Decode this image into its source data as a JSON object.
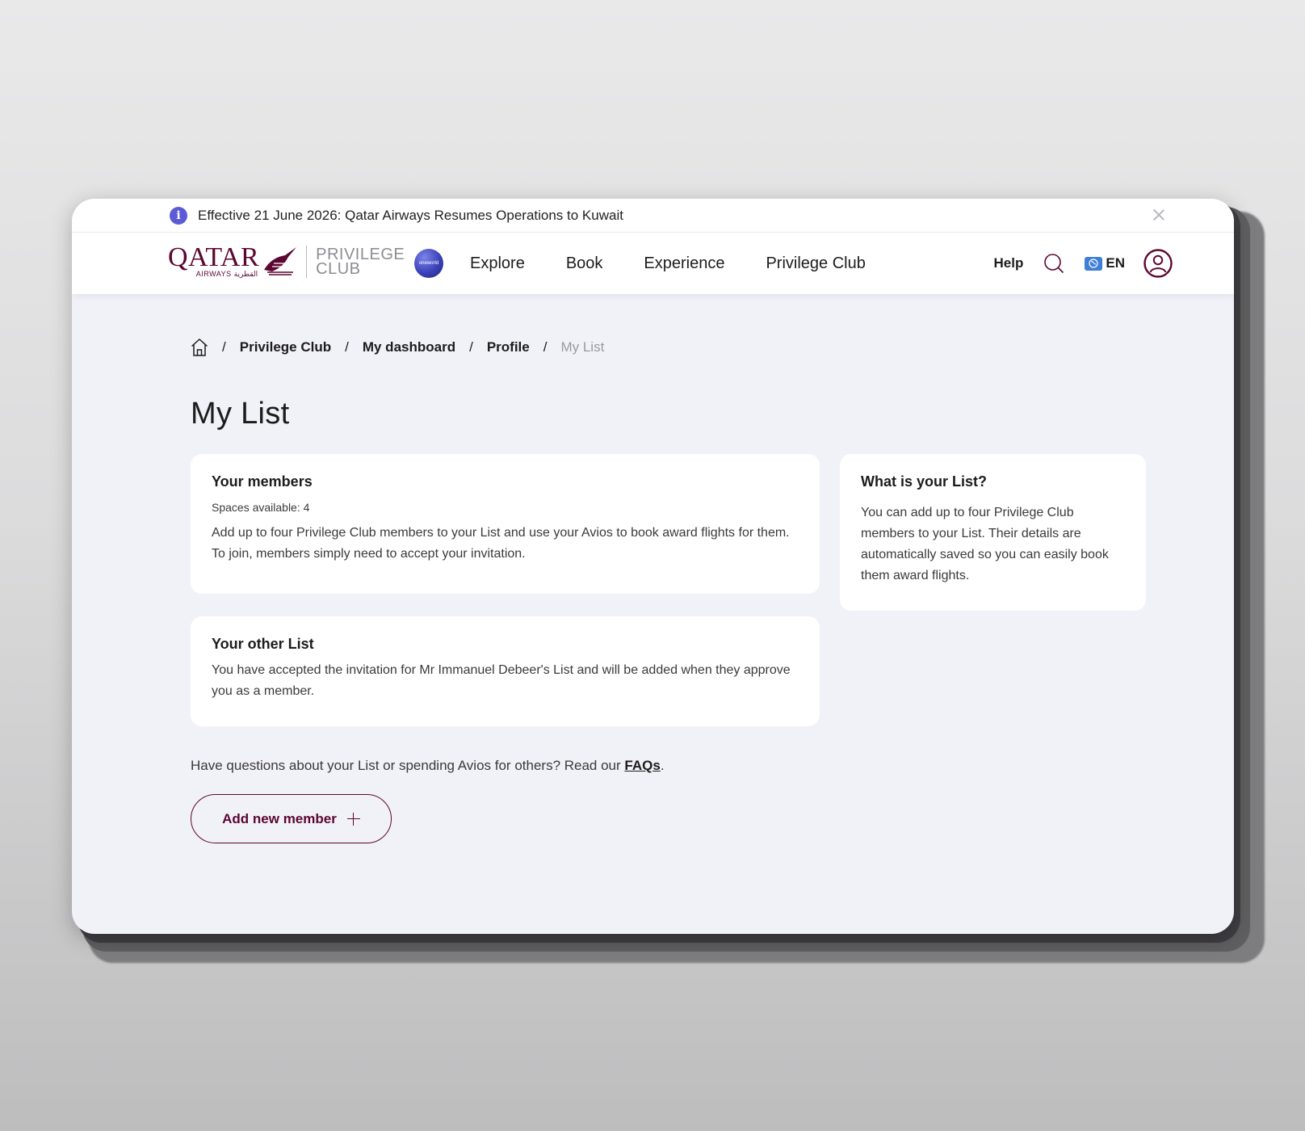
{
  "announcement": {
    "text": "Effective 21 June 2026: Qatar Airways Resumes Operations to Kuwait",
    "info_icon": "info-icon",
    "close_icon": "close-icon"
  },
  "header": {
    "brand": {
      "name": "QATAR",
      "sub": "AIRWAYS القطرية",
      "program": [
        "PRIVILEGE",
        "CLUB"
      ]
    },
    "alliance_badge": "oneworld",
    "nav": [
      "Explore",
      "Book",
      "Experience",
      "Privilege Club"
    ],
    "help_label": "Help",
    "search_icon": "search-icon",
    "language": "EN",
    "profile_icon": "user-icon"
  },
  "breadcrumb": {
    "home_icon": "home-icon",
    "items": [
      "Privilege Club",
      "My dashboard",
      "Profile"
    ],
    "current": "My List",
    "separator": "/"
  },
  "page": {
    "title": "My List"
  },
  "members_card": {
    "title": "Your members",
    "spaces": "Spaces available: 4",
    "description": "Add up to four Privilege Club members to your List and use your Avios to book award flights for them. To join, members simply need to accept your invitation."
  },
  "other_list_card": {
    "title": "Your other List",
    "description": "You have accepted the invitation for Mr Immanuel Debeer's List and will be added when they approve you as a member."
  },
  "info_card": {
    "title": "What is your List?",
    "description": "You can add up to four Privilege Club members to your List. Their details are automatically saved so you can easily book them award flights."
  },
  "faq": {
    "prefix": "Have questions about your List or spending Avios for others? Read our ",
    "link": "FAQs",
    "suffix": "."
  },
  "add_member": {
    "label": "Add new member"
  },
  "colors": {
    "brand": "#5c0632",
    "page_bg": "#f1f1f8",
    "card_bg": "#ffffff",
    "info_accent": "#5b5bd6",
    "muted_text": "#9a9aa2"
  }
}
